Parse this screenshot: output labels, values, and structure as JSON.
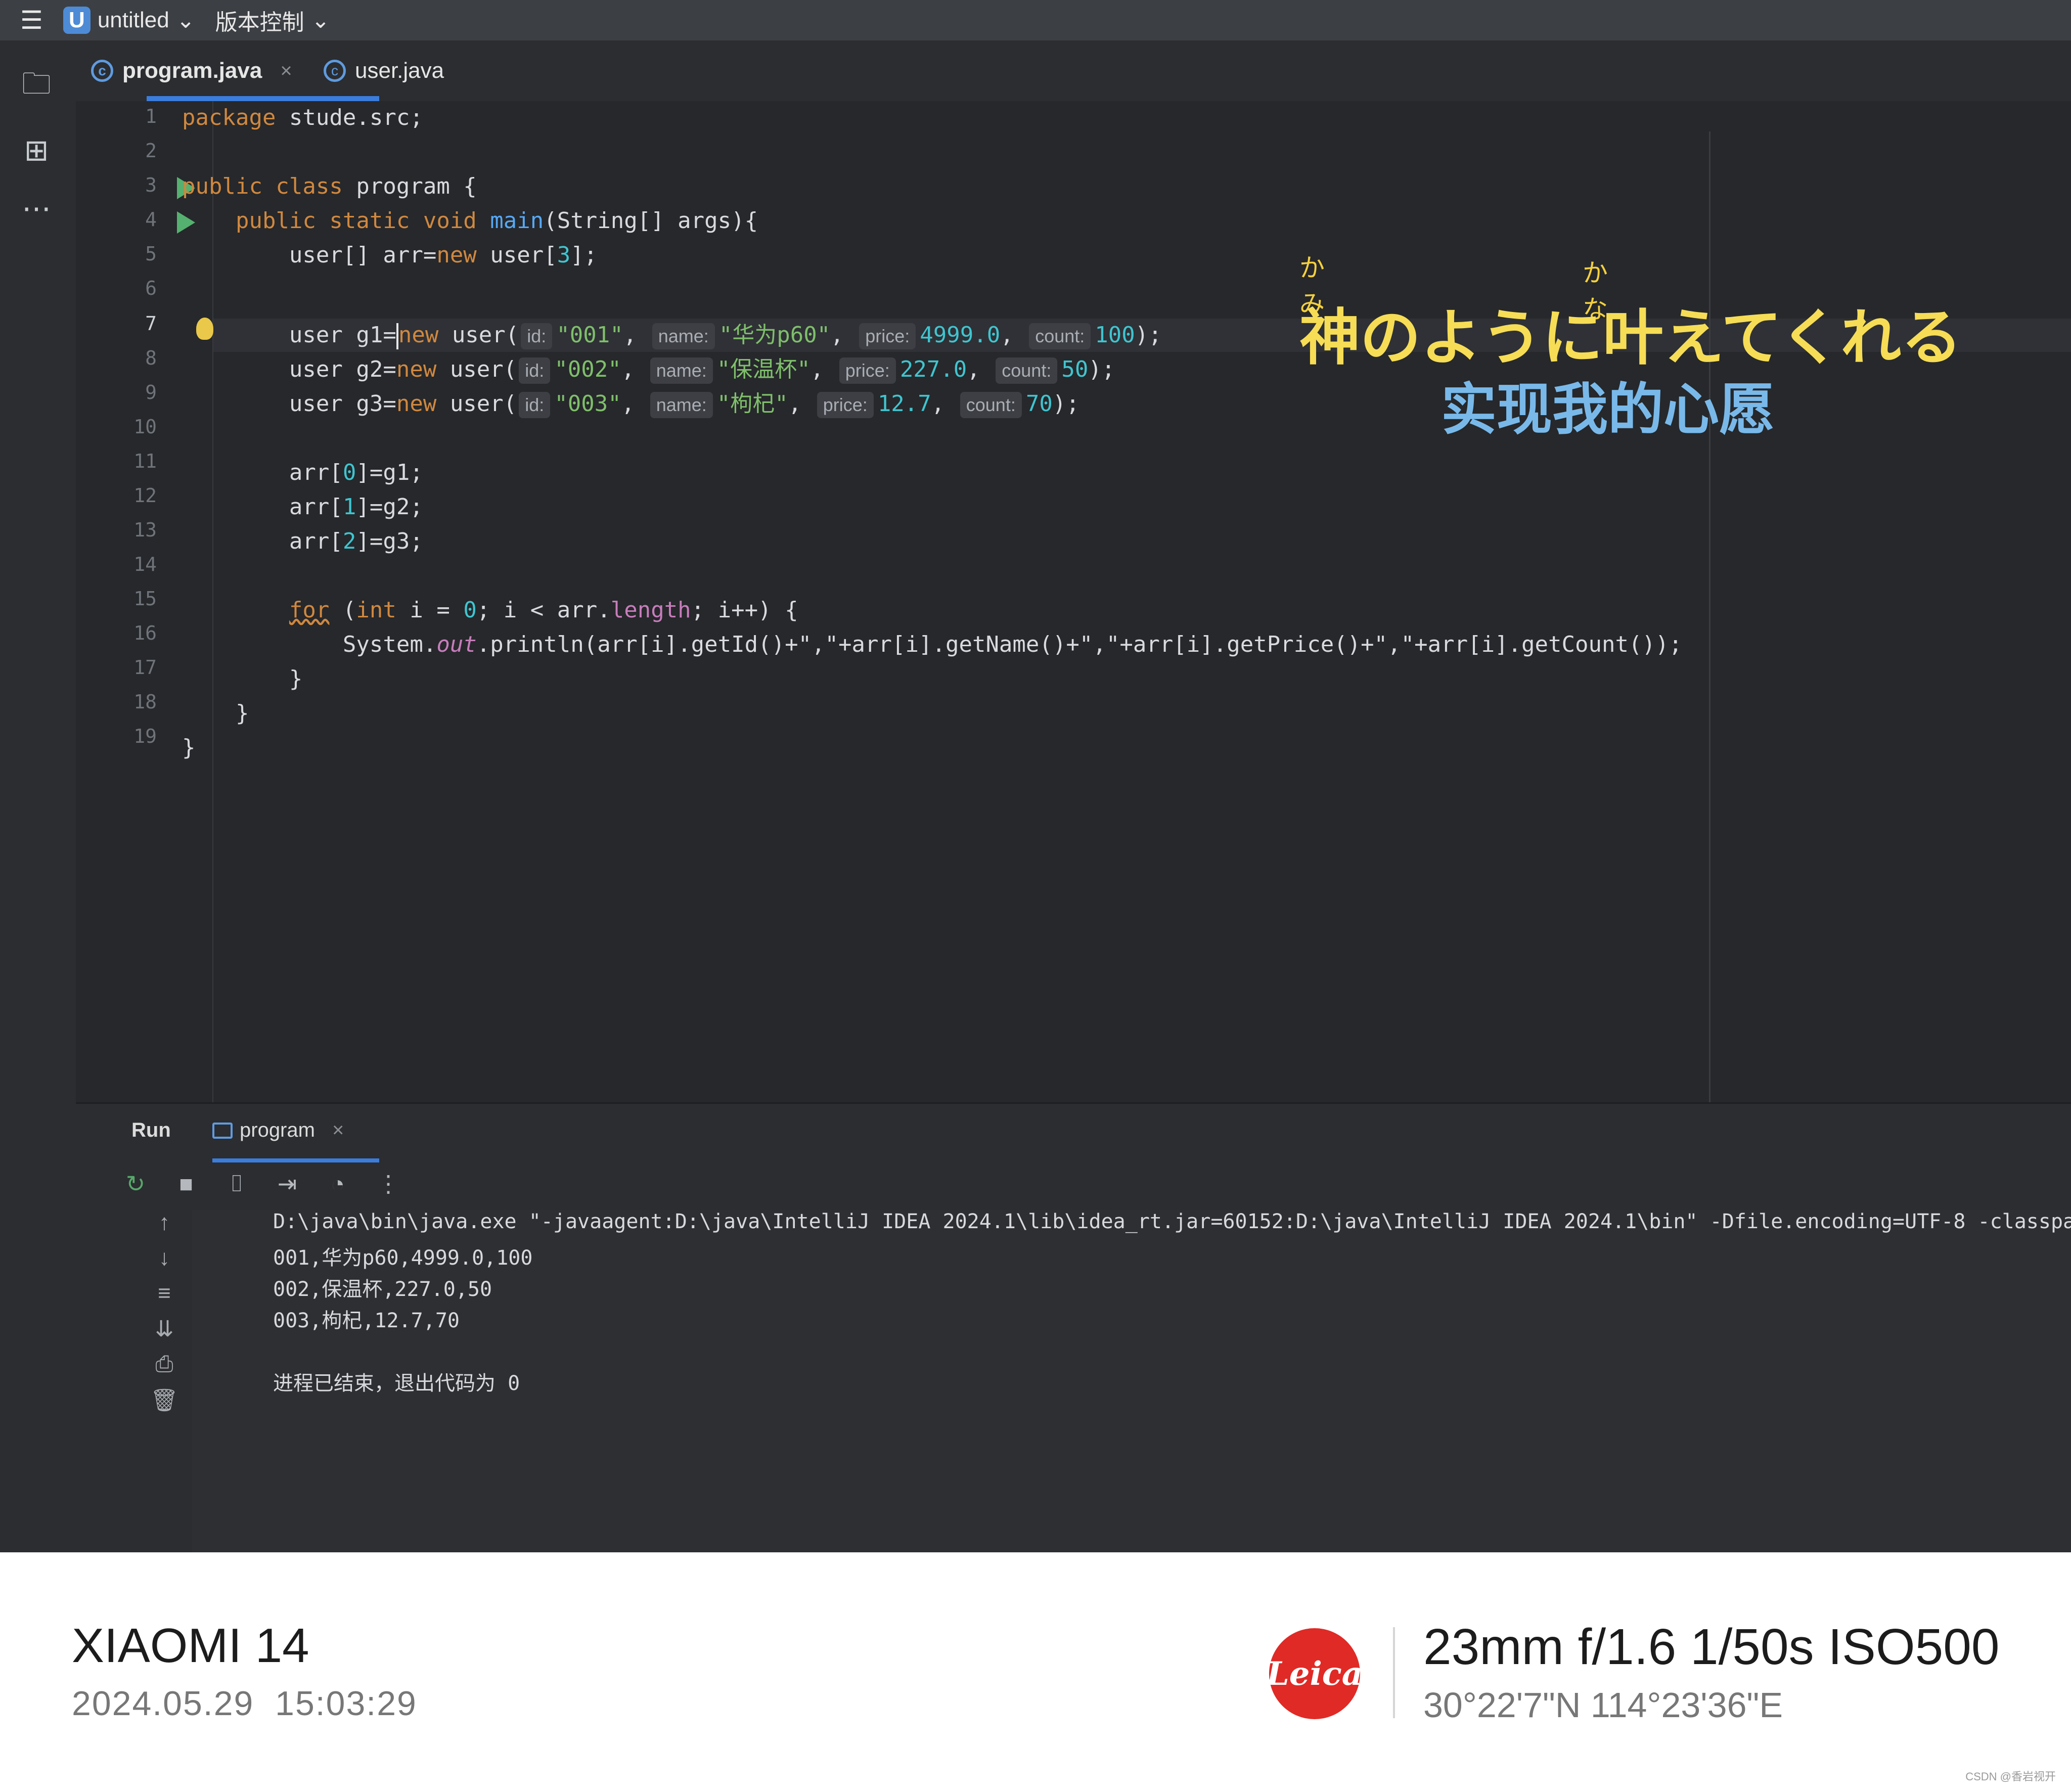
{
  "topbar": {
    "project_badge": "U",
    "project_name": "untitled",
    "vcs_menu": "版本控制"
  },
  "tabs": [
    {
      "label": "program.java",
      "icon": "java-class-icon",
      "active": true
    },
    {
      "label": "user.java",
      "icon": "java-class-icon",
      "active": false
    }
  ],
  "editor": {
    "line_numbers": [
      "1",
      "2",
      "3",
      "4",
      "5",
      "6",
      "7",
      "8",
      "9",
      "10",
      "11",
      "12",
      "13",
      "14",
      "15",
      "16",
      "17",
      "18",
      "19"
    ],
    "current_line": "7",
    "code": {
      "l1_kw": "package",
      "l1_rest": " stude.src;",
      "l3_kw": "public class",
      "l3_rest": " program {",
      "l4_indent": "    ",
      "l4_kw": "public static void",
      "l4_fn": " main",
      "l4_rest": "(String[] args){",
      "l5_a": "        user[] arr=",
      "l5_kw": "new",
      "l5_b": " user[",
      "l5_num": "3",
      "l5_c": "];",
      "users": [
        {
          "var": "        user g1=",
          "id": "\"001\"",
          "name": "\"华为p60\"",
          "price": "4999.0",
          "count": "100"
        },
        {
          "var": "        user g2=",
          "id": "\"002\"",
          "name": "\"保温杯\"",
          "price": "227.0",
          "count": "50"
        },
        {
          "var": "        user g3=",
          "id": "\"003\"",
          "name": "\"枸杞\"",
          "price": "12.7",
          "count": "70"
        }
      ],
      "hint_id": "id:",
      "hint_name": "name:",
      "hint_price": "price:",
      "hint_count": "count:",
      "kw_new": "new",
      "ctor": " user(",
      "comma": ", ",
      "end_paren": ");",
      "arr_lines": [
        {
          "pre": "        arr[",
          "idx": "0",
          "post": "]=g1;"
        },
        {
          "pre": "        arr[",
          "idx": "1",
          "post": "]=g2;"
        },
        {
          "pre": "        arr[",
          "idx": "2",
          "post": "]=g3;"
        }
      ],
      "l15_indent": "        ",
      "l15_for": "for",
      "l15_a": " (",
      "l15_int": "int",
      "l15_b": " i = ",
      "l15_zero": "0",
      "l15_c": "; i < arr.",
      "l15_len": "length",
      "l15_d": "; i++) {",
      "l16_a": "            System.",
      "l16_out": "out",
      "l16_b": ".println(arr[i].getId()+\",\"+arr[i].getName()+\",\"+arr[i].getPrice()+\",\"+arr[i].getCount());",
      "l17": "        }",
      "l18": "    }",
      "l19": "}"
    }
  },
  "lyrics": {
    "ruby_1": "かみ",
    "ruby_2": "かな",
    "line_1": "神のように叶えてくれる",
    "line_2": "实现我的心愿"
  },
  "run_panel": {
    "title": "Run",
    "tab_label": "program",
    "console_lines": [
      "D:\\java\\bin\\java.exe \"-javaagent:D:\\java\\IntelliJ IDEA 2024.1\\lib\\idea_rt.jar=60152:D:\\java\\IntelliJ IDEA 2024.1\\bin\" -Dfile.encoding=UTF-8 -classpath D:\\java\\",
      "001,华为p60,4999.0,100",
      "002,保温杯,227.0,50",
      "003,枸杞,12.7,70",
      "",
      "进程已结束，退出代码为 0"
    ]
  },
  "footer": {
    "device": "XIAOMI 14",
    "date": "2024.05.29",
    "time": "15:03:29",
    "leica_logo": "Leica",
    "exif": "23mm  f/1.6  1/50s  ISO500",
    "gps": "30°22'7\"N  114°23'36\"E",
    "watermark": "CSDN @香岩视开"
  },
  "colors": {
    "editor_bg": "#26282b",
    "keyword": "#d0883f",
    "function": "#57a8f5",
    "string": "#7fbf6b",
    "number": "#3fc5d0",
    "accent": "#3b7ddd",
    "leica_red": "#e02a26"
  }
}
